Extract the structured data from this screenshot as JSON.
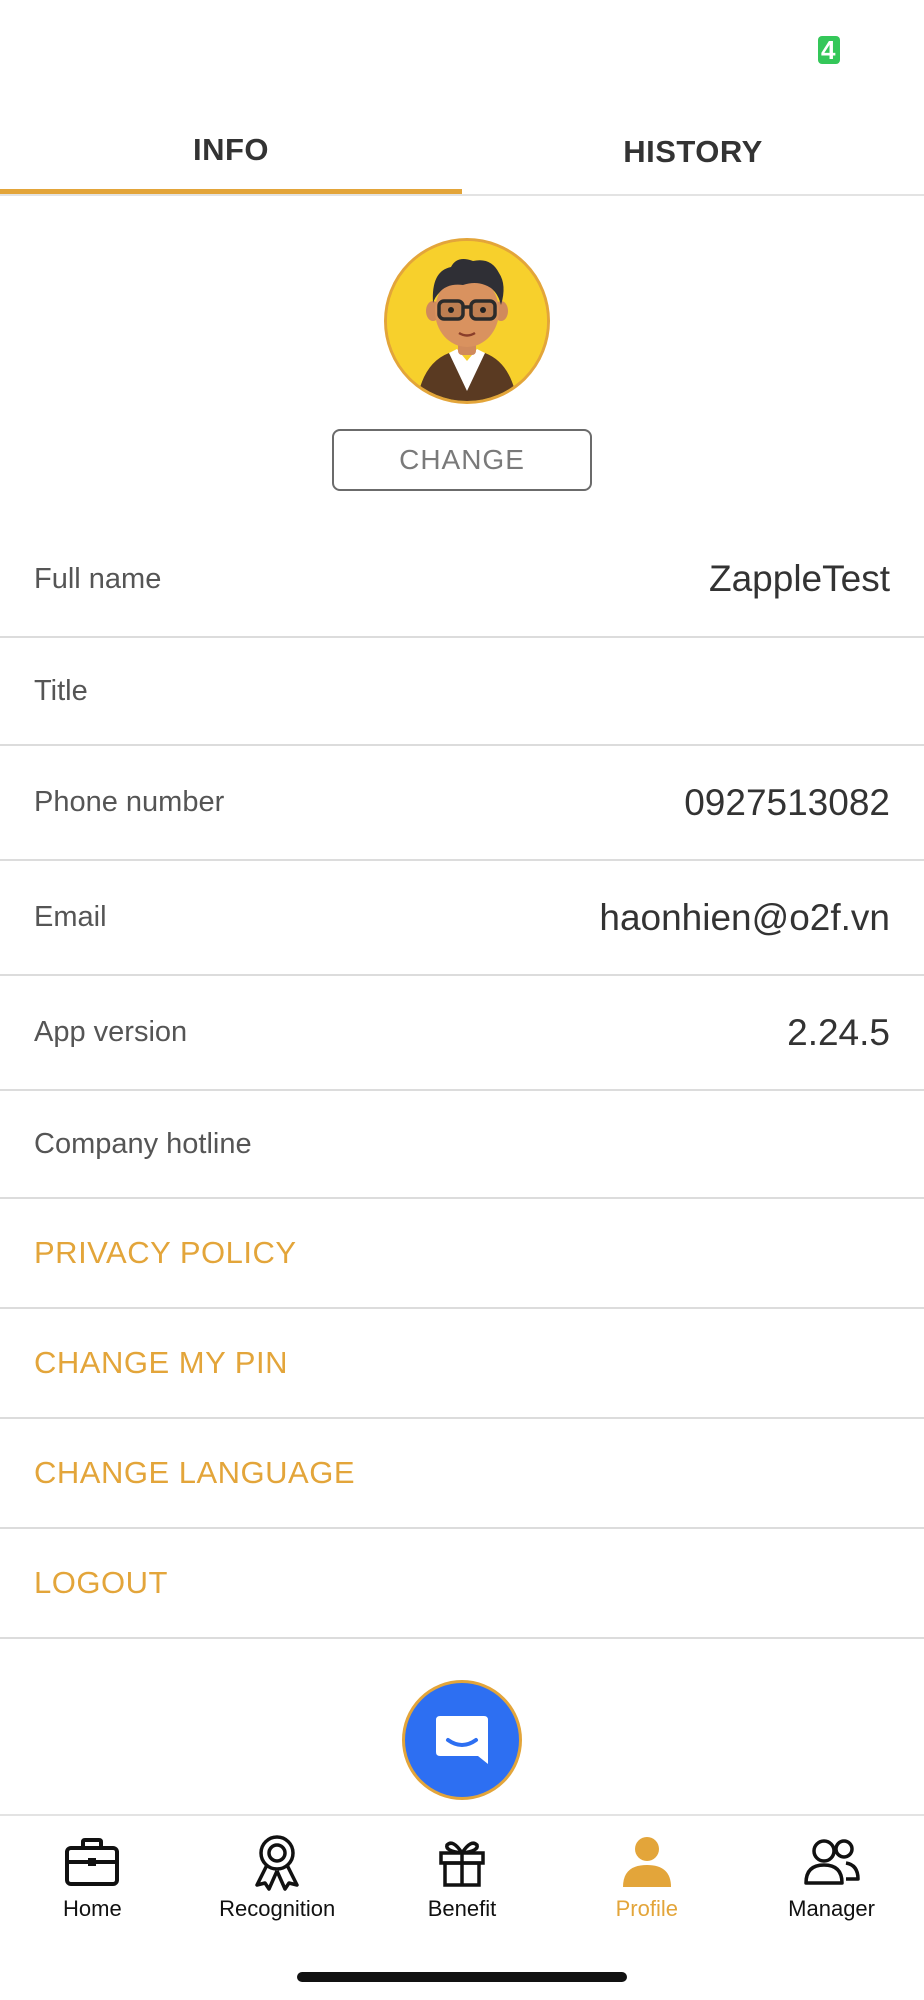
{
  "status_bar": {
    "battery_text": "4"
  },
  "tabs": [
    {
      "label": "INFO",
      "active": true
    },
    {
      "label": "HISTORY",
      "active": false
    }
  ],
  "avatar": {
    "icon": "avatar-cartoon-man-glasses",
    "change_label": "CHANGE"
  },
  "info_rows": [
    {
      "label": "Full name",
      "value": "ZappleTest"
    },
    {
      "label": "Title",
      "value": ""
    },
    {
      "label": "Phone number",
      "value": "0927513082"
    },
    {
      "label": "Email",
      "value": "haonhien@o2f.vn"
    },
    {
      "label": "App version",
      "value": "2.24.5"
    },
    {
      "label": "Company hotline",
      "value": ""
    }
  ],
  "actions": [
    {
      "label": "PRIVACY POLICY"
    },
    {
      "label": "CHANGE MY PIN"
    },
    {
      "label": "CHANGE LANGUAGE"
    },
    {
      "label": "LOGOUT"
    }
  ],
  "chat_fab": {
    "icon": "chat-bubble-icon"
  },
  "bottom_nav": [
    {
      "label": "Home",
      "icon": "briefcase-icon",
      "active": false
    },
    {
      "label": "Recognition",
      "icon": "award-ribbon-icon",
      "active": false
    },
    {
      "label": "Benefit",
      "icon": "gift-icon",
      "active": false
    },
    {
      "label": "Profile",
      "icon": "person-icon",
      "active": true
    },
    {
      "label": "Manager",
      "icon": "people-icon",
      "active": false
    }
  ],
  "colors": {
    "accent": "#e3a53a",
    "fab_blue": "#2d6ff2",
    "battery_green": "#34c759",
    "avatar_bg": "#f7d02c"
  }
}
